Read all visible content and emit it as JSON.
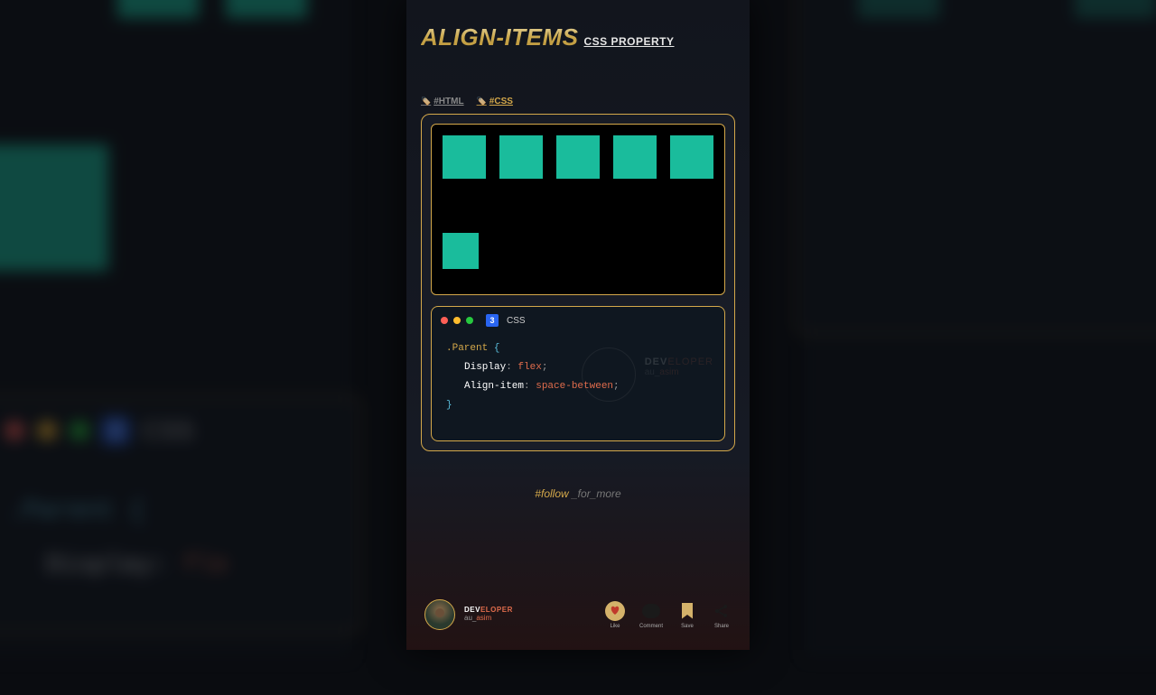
{
  "title": {
    "main": "ALIGN-ITEMS",
    "sub": "CSS PROPERTY"
  },
  "tabs": [
    {
      "label": "#HTML",
      "active": false
    },
    {
      "label": "#CSS",
      "active": true
    }
  ],
  "demo": {
    "box_count": 6
  },
  "code": {
    "lang": "CSS",
    "selector": ".Parent",
    "open": "{",
    "close": "}",
    "lines": [
      {
        "prop": "Display",
        "val": "flex"
      },
      {
        "prop": "Align-item",
        "val": "space-between"
      }
    ]
  },
  "watermark": {
    "dev_white": "DEV",
    "dev_orange": "ELOPER",
    "handle_pre": "au_",
    "handle_name": "asim"
  },
  "hashtag": {
    "hash": "#",
    "follow": "follow",
    "rest": " _for_more"
  },
  "author": {
    "dev_white": "DEV",
    "dev_orange": "ELOPER",
    "handle_pre": "au_",
    "handle_name": "asim"
  },
  "actions": {
    "like": "Like",
    "comment": "Comment",
    "save": "Save",
    "share": "Share"
  },
  "colors": {
    "gold": "#d4a84a",
    "teal": "#1abc9c",
    "orange": "#e06c4c"
  },
  "background_code": {
    "lang": "CSS",
    "selector": ".Parent {",
    "line": "Display: flex"
  }
}
